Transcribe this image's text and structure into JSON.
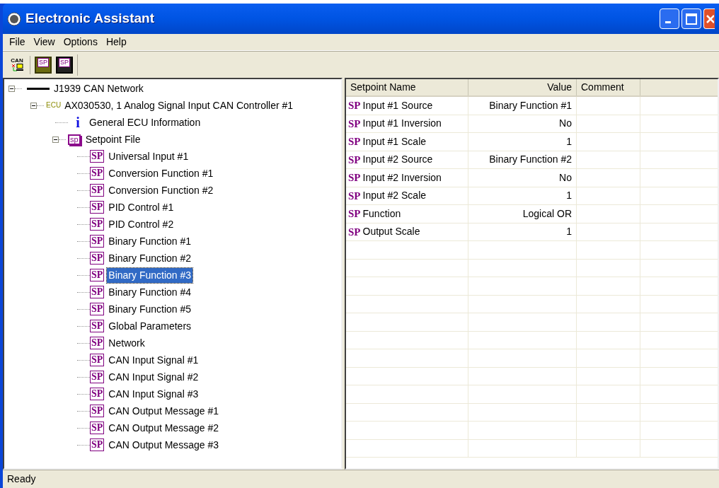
{
  "window": {
    "title": "Electronic Assistant"
  },
  "menu": [
    "File",
    "View",
    "Options",
    "Help"
  ],
  "toolbar": [
    {
      "kind": "can",
      "label": "CAN"
    },
    {
      "kind": "open",
      "label": "SP"
    },
    {
      "kind": "save",
      "label": "SP"
    }
  ],
  "tree": [
    {
      "label": "J1939 CAN Network",
      "kind": "network",
      "expanded": true,
      "selected": false,
      "children": [
        {
          "label": "AX030530, 1 Analog Signal Input CAN Controller #1",
          "kind": "ecu",
          "badge": "ECU",
          "expanded": true,
          "selected": false,
          "children": [
            {
              "label": "General ECU Information",
              "kind": "info",
              "badge": "i",
              "selected": false
            },
            {
              "label": "Setpoint File",
              "kind": "file",
              "badge": "sp",
              "expanded": true,
              "selected": false,
              "children": [
                {
                  "label": "Universal Input #1",
                  "kind": "setpoint",
                  "badge": "SP",
                  "selected": false
                },
                {
                  "label": "Conversion Function #1",
                  "kind": "setpoint",
                  "badge": "SP",
                  "selected": false
                },
                {
                  "label": "Conversion Function #2",
                  "kind": "setpoint",
                  "badge": "SP",
                  "selected": false
                },
                {
                  "label": "PID Control #1",
                  "kind": "setpoint",
                  "badge": "SP",
                  "selected": false
                },
                {
                  "label": "PID Control #2",
                  "kind": "setpoint",
                  "badge": "SP",
                  "selected": false
                },
                {
                  "label": "Binary Function #1",
                  "kind": "setpoint",
                  "badge": "SP",
                  "selected": false
                },
                {
                  "label": "Binary Function #2",
                  "kind": "setpoint",
                  "badge": "SP",
                  "selected": false
                },
                {
                  "label": "Binary Function #3",
                  "kind": "setpoint",
                  "badge": "SP",
                  "selected": true
                },
                {
                  "label": "Binary Function #4",
                  "kind": "setpoint",
                  "badge": "SP",
                  "selected": false
                },
                {
                  "label": "Binary Function #5",
                  "kind": "setpoint",
                  "badge": "SP",
                  "selected": false
                },
                {
                  "label": "Global Parameters",
                  "kind": "setpoint",
                  "badge": "SP",
                  "selected": false
                },
                {
                  "label": "Network",
                  "kind": "setpoint",
                  "badge": "SP",
                  "selected": false
                },
                {
                  "label": "CAN Input Signal #1",
                  "kind": "setpoint",
                  "badge": "SP",
                  "selected": false
                },
                {
                  "label": "CAN Input Signal #2",
                  "kind": "setpoint",
                  "badge": "SP",
                  "selected": false
                },
                {
                  "label": "CAN Input Signal #3",
                  "kind": "setpoint",
                  "badge": "SP",
                  "selected": false
                },
                {
                  "label": "CAN Output Message #1",
                  "kind": "setpoint",
                  "badge": "SP",
                  "selected": false
                },
                {
                  "label": "CAN Output Message #2",
                  "kind": "setpoint",
                  "badge": "SP",
                  "selected": false
                },
                {
                  "label": "CAN Output Message #3",
                  "kind": "setpoint",
                  "badge": "SP",
                  "selected": false
                }
              ]
            }
          ]
        }
      ]
    }
  ],
  "table": {
    "columns": [
      "Setpoint Name",
      "Value",
      "Comment"
    ],
    "rows": [
      {
        "badge": "SP",
        "name": "Input #1 Source",
        "value": "Binary Function #1"
      },
      {
        "badge": "SP",
        "name": "Input #1 Inversion",
        "value": "No"
      },
      {
        "badge": "SP",
        "name": "Input #1 Scale",
        "value": "1"
      },
      {
        "badge": "SP",
        "name": "Input #2 Source",
        "value": "Binary Function #2"
      },
      {
        "badge": "SP",
        "name": "Input #2 Inversion",
        "value": "No"
      },
      {
        "badge": "SP",
        "name": "Input #2 Scale",
        "value": "1"
      },
      {
        "badge": "SP",
        "name": "Function",
        "value": "Logical OR"
      },
      {
        "badge": "SP",
        "name": "Output Scale",
        "value": "1"
      }
    ]
  },
  "status_bar": "Ready"
}
